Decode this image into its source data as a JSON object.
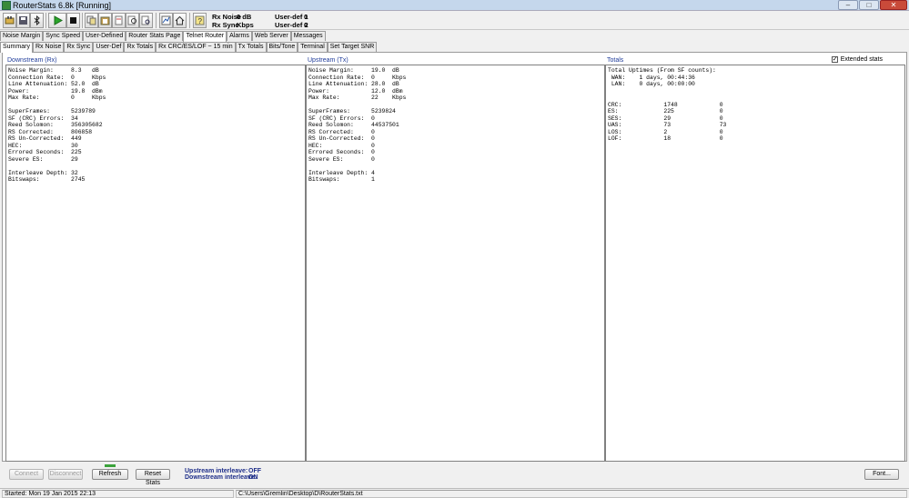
{
  "window": {
    "title": "RouterStats 6.8k  [Running]"
  },
  "toolbar": {
    "rx_noise_label": "Rx Noise",
    "rx_noise_value": "0 dB",
    "rx_sync_label": "Rx Sync",
    "rx_sync_value": "Kbps",
    "user_def1_label": "User-def 1",
    "user_def1_value": "0",
    "user_def2_label": "User-def 2",
    "user_def2_value": "0"
  },
  "tabs_row1": [
    "Noise Margin",
    "Sync Speed",
    "User-Defined",
    "Router Stats Page",
    "Telnet Router",
    "Alarms",
    "Web Server",
    "Messages"
  ],
  "tabs_row2": [
    "Summary",
    "Rx Noise",
    "Rx Sync",
    "User-Def",
    "Rx  Totals",
    "Rx CRC/ES/LOF ~ 15 min",
    "Tx  Totals",
    "Bits/Tone",
    "Terminal",
    "Set Target SNR"
  ],
  "columns": {
    "downstream": "Downstream (Rx)",
    "upstream": "Upstream (Tx)",
    "totals": "Totals"
  },
  "extended_stats": {
    "label": "Extended stats",
    "checked": "✓"
  },
  "downstream_text": "Noise Margin:     8.3   dB\nConnection Rate:  0     Kbps\nLine Attenuation: 52.0  dB\nPower:            19.8  dBm\nMax Rate:         0     Kbps\n\nSuperFrames:      5239789\nSF (CRC) Errors:  34\nReed Solomon:     356305682\nRS Corrected:     806858\nRS Un-Corrected:  449\nHEC:              30\nErrored Seconds:  225\nSevere ES:        29\n\nInterleave Depth: 32\nBitswaps:         2745",
  "upstream_text": "Noise Margin:     19.0  dB\nConnection Rate:  0     Kbps\nLine Attenuation: 28.0  dB\nPower:            12.0  dBm\nMax Rate:         22    Kbps\n\nSuperFrames:      5239824\nSF (CRC) Errors:  0\nReed Solomon:     44537501\nRS Corrected:     0\nRS Un-Corrected:  0\nHEC:              0\nErrored Seconds:  0\nSevere ES:        0\n\nInterleave Depth: 4\nBitswaps:         1",
  "totals_text": "Total Uptimes (From SF counts):\n WAN:    1 days, 00:44:36\n LAN:    0 days, 00:00:00\n\n\nCRC:            1748            0\nES:             225             0\nSES:            29              0\nUAS:            73              73\nLOS:            2               0\nLOF:            18              0",
  "buttons": {
    "connect": "Connect",
    "disconnect": "Disconnect",
    "refresh": "Refresh",
    "reset_stats": "Reset Stats",
    "font": "Font..."
  },
  "interleave": {
    "upstream_label": "Upstream interleave:",
    "upstream_value": "OFF",
    "downstream_label": "Downstream interleave:",
    "downstream_value": "ON"
  },
  "status": {
    "started": "Started: Mon 19 Jan 2015   22:13",
    "path": "C:\\Users\\Gremlin\\Desktop\\D\\RouterStats.txt"
  }
}
